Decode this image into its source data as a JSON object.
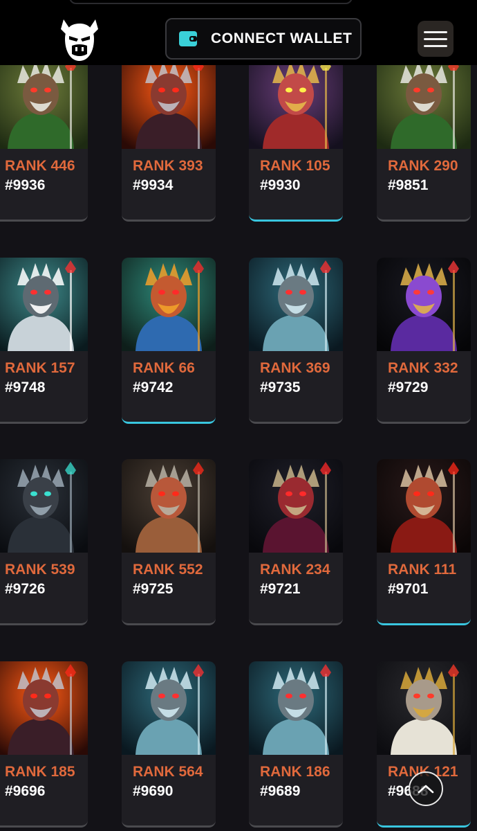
{
  "header": {
    "logo_icon": "gorilla-skull-logo-icon",
    "wallet_button": {
      "icon": "wallet-icon",
      "label": "CONNECT WALLET",
      "icon_color": "#3ad0d8"
    },
    "menu_icon": "hamburger-menu-icon"
  },
  "colors": {
    "rank": "#e0693c",
    "highlight_underline": "#39c6df",
    "card_bg": "#1f1e23",
    "page_bg": "#131217"
  },
  "cards": [
    {
      "rank": "RANK 446",
      "id": "#9936",
      "highlight": false,
      "theme": "forest"
    },
    {
      "rank": "RANK 393",
      "id": "#9934",
      "highlight": false,
      "theme": "fire"
    },
    {
      "rank": "RANK 105",
      "id": "#9930",
      "highlight": true,
      "theme": "storm"
    },
    {
      "rank": "RANK 290",
      "id": "#9851",
      "highlight": false,
      "theme": "forest"
    },
    {
      "rank": "RANK 157",
      "id": "#9748",
      "highlight": false,
      "theme": "frost"
    },
    {
      "rank": "RANK 66",
      "id": "#9742",
      "highlight": true,
      "theme": "phoenix"
    },
    {
      "rank": "RANK 369",
      "id": "#9735",
      "highlight": false,
      "theme": "ice"
    },
    {
      "rank": "RANK 332",
      "id": "#9729",
      "highlight": false,
      "theme": "violet"
    },
    {
      "rank": "RANK 539",
      "id": "#9726",
      "highlight": false,
      "theme": "obsidian"
    },
    {
      "rank": "RANK 552",
      "id": "#9725",
      "highlight": false,
      "theme": "bronze"
    },
    {
      "rank": "RANK 234",
      "id": "#9721",
      "highlight": false,
      "theme": "crimson"
    },
    {
      "rank": "RANK 111",
      "id": "#9701",
      "highlight": true,
      "theme": "ember"
    },
    {
      "rank": "RANK 185",
      "id": "#9696",
      "highlight": false,
      "theme": "fire"
    },
    {
      "rank": "RANK 564",
      "id": "#9690",
      "highlight": false,
      "theme": "ice"
    },
    {
      "rank": "RANK 186",
      "id": "#9689",
      "highlight": false,
      "theme": "ice"
    },
    {
      "rank": "RANK 121",
      "id": "#9688",
      "highlight": true,
      "theme": "sage"
    }
  ],
  "scroll_top": {
    "icon": "chevron-up-icon"
  }
}
